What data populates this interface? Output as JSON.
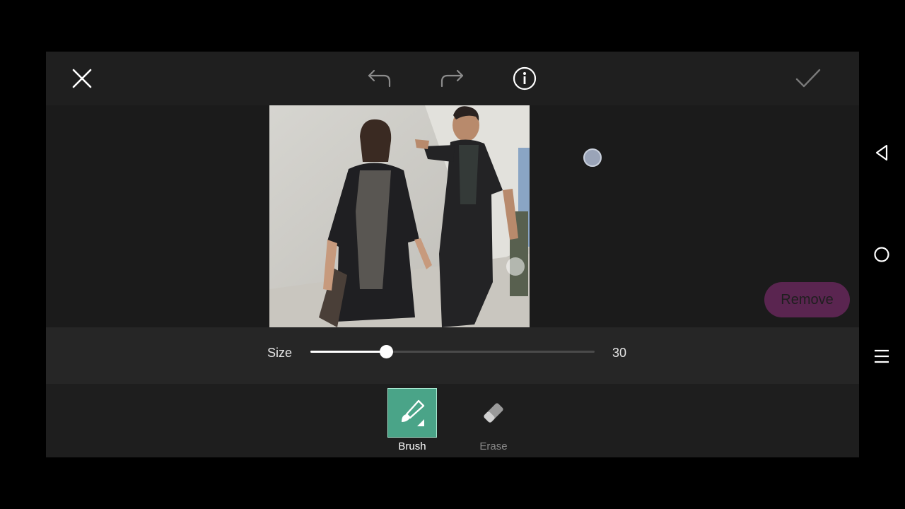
{
  "toolbar_top": {
    "close_icon": "close-icon",
    "undo_icon": "undo-icon",
    "redo_icon": "redo-icon",
    "info_icon": "info-icon",
    "apply_icon": "check-icon"
  },
  "canvas": {
    "image_description": "photo",
    "remove_label": "Remove"
  },
  "size_control": {
    "label": "Size",
    "value": "30",
    "fraction": 0.265
  },
  "tools": [
    {
      "label": "Brush",
      "icon": "brush-icon",
      "active": true
    },
    {
      "label": "Erase",
      "icon": "eraser-icon",
      "active": false
    }
  ],
  "system_nav": {
    "back_icon": "back-triangle-icon",
    "home_icon": "home-circle-icon",
    "menu_icon": "menu-lines-icon"
  },
  "colors": {
    "accent": "#4aa488",
    "remove_button": "#5a2550",
    "background": "#1a1a1a"
  }
}
